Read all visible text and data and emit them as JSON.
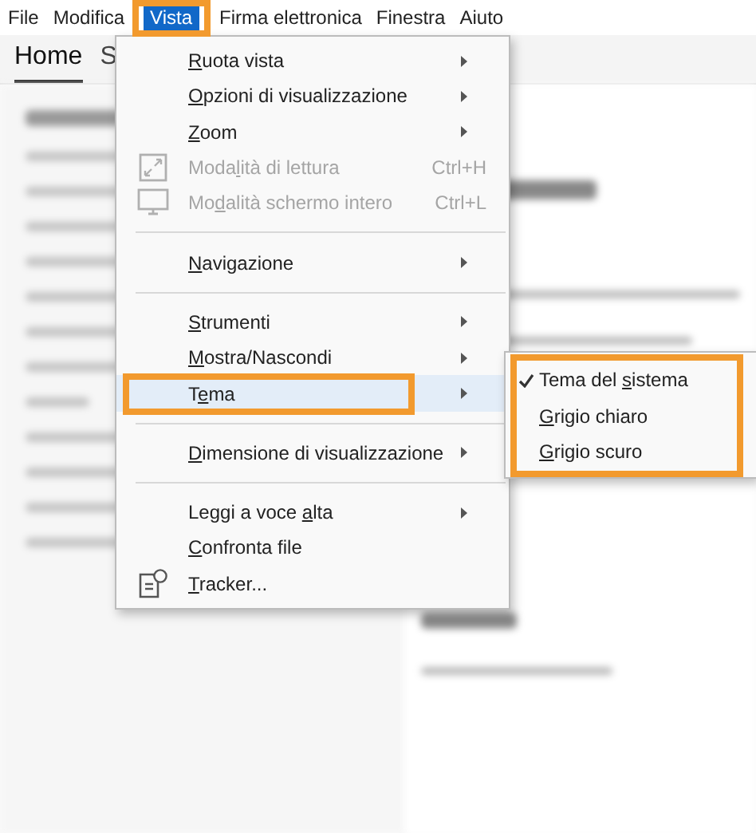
{
  "menubar": [
    {
      "label": "File",
      "selected": false,
      "highlighted": false
    },
    {
      "label": "Modifica",
      "selected": false,
      "highlighted": false
    },
    {
      "label": "Vista",
      "selected": true,
      "highlighted": true
    },
    {
      "label": "Firma elettronica",
      "selected": false,
      "highlighted": false
    },
    {
      "label": "Finestra",
      "selected": false,
      "highlighted": false
    },
    {
      "label": "Aiuto",
      "selected": false,
      "highlighted": false
    }
  ],
  "tabs": [
    {
      "label": "Home",
      "selected": true
    },
    {
      "label": "S",
      "selected": false
    }
  ],
  "menu": {
    "items": [
      {
        "kind": "submenu",
        "label": "Ruota vista"
      },
      {
        "kind": "submenu",
        "label": "Opzioni di visualizzazione"
      },
      {
        "kind": "submenu",
        "label": "Zoom"
      },
      {
        "kind": "command",
        "label": "Modalità di lettura",
        "shortcut": "Ctrl+H",
        "disabled": true
      },
      {
        "kind": "command",
        "label": "Modalità schermo intero",
        "shortcut": "Ctrl+L",
        "disabled": true
      },
      {
        "kind": "separator"
      },
      {
        "kind": "submenu",
        "label": "Navigazione"
      },
      {
        "kind": "separator"
      },
      {
        "kind": "submenu",
        "label": "Strumenti"
      },
      {
        "kind": "submenu",
        "label": "Mostra/Nascondi"
      },
      {
        "kind": "submenu",
        "label": "Tema",
        "selected": true,
        "highlighted": true
      },
      {
        "kind": "separator"
      },
      {
        "kind": "submenu",
        "label": "Dimensione di visualizzazione"
      },
      {
        "kind": "separator"
      },
      {
        "kind": "submenu",
        "label": "Leggi a voce alta"
      },
      {
        "kind": "command",
        "label": "Confronta file"
      },
      {
        "kind": "command",
        "label": "Tracker..."
      }
    ]
  },
  "submenu": {
    "highlighted": true,
    "items": [
      {
        "label": "Tema del sistema",
        "checked": true
      },
      {
        "label": "Grigio chiaro",
        "checked": false
      },
      {
        "label": "Grigio scuro",
        "checked": false
      }
    ]
  }
}
